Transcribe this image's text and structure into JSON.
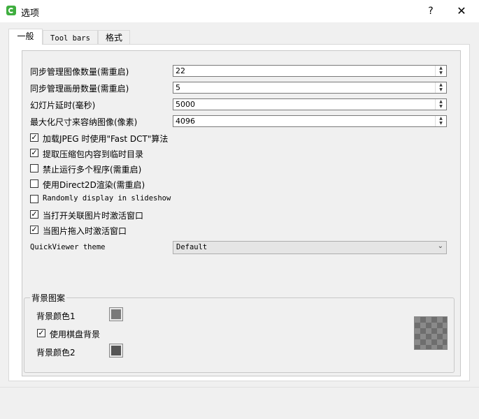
{
  "window": {
    "title": "选项",
    "help": "?",
    "close": "✕"
  },
  "tabs": [
    {
      "label": "一般"
    },
    {
      "label": "Tool bars"
    },
    {
      "label": "格式"
    }
  ],
  "general": {
    "spins": [
      {
        "label": "同步管理图像数量(需重启)",
        "value": "22"
      },
      {
        "label": "同步管理画册数量(需重启)",
        "value": "5"
      },
      {
        "label": "幻灯片延时(毫秒)",
        "value": "5000"
      },
      {
        "label": "最大化尺寸来容纳图像(像素)",
        "value": "4096"
      }
    ],
    "checks": [
      {
        "label": "加载JPEG 时使用\"Fast DCT\"算法",
        "checked": true
      },
      {
        "label": "提取压缩包内容到临时目录",
        "checked": true
      },
      {
        "label": "禁止运行多个程序(需重启)",
        "checked": false
      },
      {
        "label": "使用Direct2D渲染(需重启)",
        "checked": false
      },
      {
        "label": "Randomly display in slideshow",
        "checked": false
      },
      {
        "label": "当打开关联图片时激活窗口",
        "checked": true
      },
      {
        "label": "当图片拖入时激活窗口",
        "checked": true
      }
    ],
    "theme": {
      "label": "QuickViewer theme",
      "value": "Default"
    }
  },
  "background": {
    "title": "背景图案",
    "color1_label": "背景颜色1",
    "checker_label": "使用棋盘背景",
    "checker_checked": true,
    "color2_label": "背景颜色2",
    "color1": "#7a7a7a",
    "color2": "#555555"
  },
  "marks": {
    "checked": "✓",
    "unchecked": ""
  }
}
